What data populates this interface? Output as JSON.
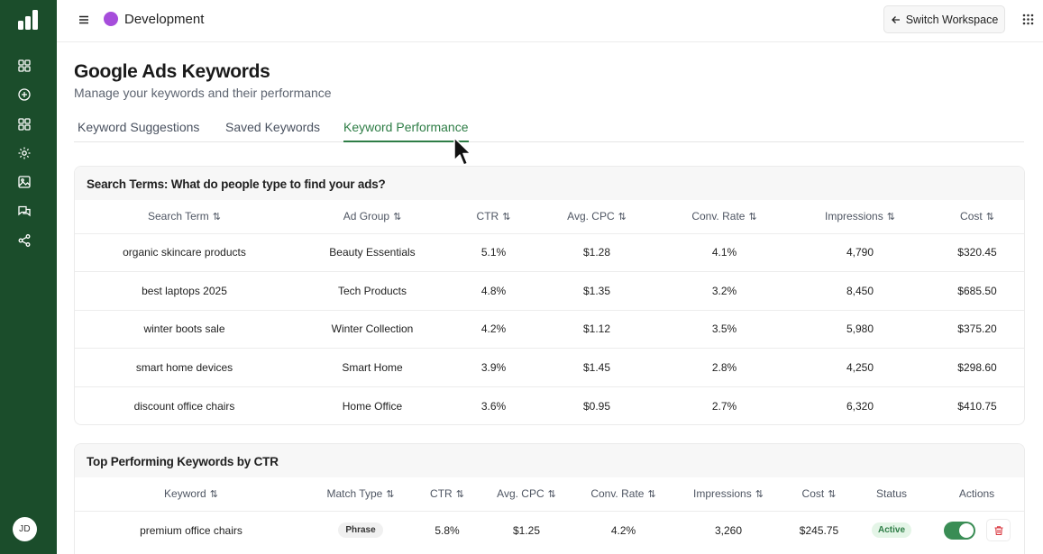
{
  "sidebar": {
    "items": [
      {
        "icon": "dashboard-icon"
      },
      {
        "icon": "add-circle-icon"
      },
      {
        "icon": "apps-icon"
      },
      {
        "icon": "gear-icon"
      },
      {
        "icon": "image-icon"
      },
      {
        "icon": "chat-icon"
      },
      {
        "icon": "share-icon"
      }
    ],
    "avatar_initials": "JD"
  },
  "header": {
    "workspace_name": "Development",
    "workspace_color": "#a64ddb",
    "switch_label": "Switch Workspace"
  },
  "page": {
    "title": "Google Ads Keywords",
    "subtitle": "Manage your keywords and their performance"
  },
  "tabs": [
    {
      "label": "Keyword Suggestions",
      "active": false
    },
    {
      "label": "Saved Keywords",
      "active": false
    },
    {
      "label": "Keyword Performance",
      "active": true
    }
  ],
  "search_terms": {
    "title": "Search Terms: What do people type to find your ads?",
    "columns": [
      "Search Term",
      "Ad Group",
      "CTR",
      "Avg. CPC",
      "Conv. Rate",
      "Impressions",
      "Cost"
    ],
    "rows": [
      [
        "organic skincare products",
        "Beauty Essentials",
        "5.1%",
        "$1.28",
        "4.1%",
        "4,790",
        "$320.45"
      ],
      [
        "best laptops 2025",
        "Tech Products",
        "4.8%",
        "$1.35",
        "3.2%",
        "8,450",
        "$685.50"
      ],
      [
        "winter boots sale",
        "Winter Collection",
        "4.2%",
        "$1.12",
        "3.5%",
        "5,980",
        "$375.20"
      ],
      [
        "smart home devices",
        "Smart Home",
        "3.9%",
        "$1.45",
        "2.8%",
        "4,250",
        "$298.60"
      ],
      [
        "discount office chairs",
        "Home Office",
        "3.6%",
        "$0.95",
        "2.7%",
        "6,320",
        "$410.75"
      ]
    ]
  },
  "top_keywords": {
    "title": "Top Performing Keywords by CTR",
    "columns": [
      "Keyword",
      "Match Type",
      "CTR",
      "Avg. CPC",
      "Conv. Rate",
      "Impressions",
      "Cost",
      "Status",
      "Actions"
    ],
    "rows": [
      [
        "premium office chairs",
        "Phrase",
        "5.8%",
        "$1.25",
        "4.2%",
        "3,260",
        "$245.75",
        "Active"
      ]
    ],
    "row_enabled": [
      true
    ]
  },
  "colors": {
    "sidebar_bg": "#1b4d2b",
    "accent": "#2e7d46",
    "delete": "#d9363e"
  }
}
